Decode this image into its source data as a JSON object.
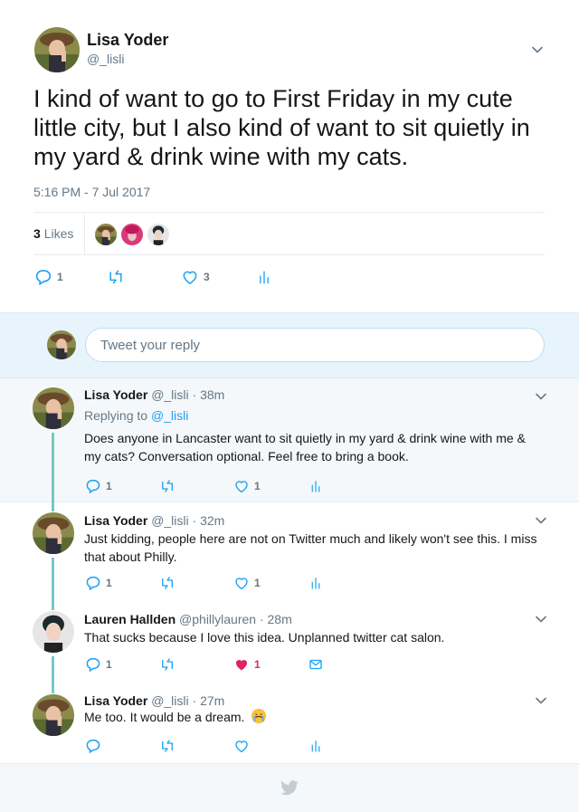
{
  "main_tweet": {
    "name": "Lisa Yoder",
    "handle": "@_lisli",
    "text": "I kind of want to go to First Friday in my cute little city, but I also kind of want to sit quietly in my yard & drink wine with my cats.",
    "timestamp": "5:16 PM - 7 Jul 2017",
    "likes_count": "3",
    "likes_label": "Likes",
    "reply_count": "1",
    "retweet_count": "",
    "like_count": "3"
  },
  "reply_box": {
    "placeholder": "Tweet your reply"
  },
  "replies": [
    {
      "name": "Lisa Yoder",
      "handle": "@_lisli",
      "time": "· 38m",
      "replying_prefix": "Replying to",
      "replying_to": "@_lisli",
      "text": "Does anyone in Lancaster want to sit quietly in my yard & drink wine with me & my cats? Conversation optional. Feel free to bring a book.",
      "reply_count": "1",
      "like_count": "1",
      "liked": false
    },
    {
      "name": "Lisa Yoder",
      "handle": "@_lisli",
      "time": "· 32m",
      "text": "Just kidding, people here are not on Twitter much and likely won't see this. I miss that about Philly.",
      "reply_count": "1",
      "like_count": "1",
      "liked": false
    },
    {
      "name": "Lauren Hallden",
      "handle": "@phillylauren",
      "time": "· 28m",
      "text": "That sucks because I love this idea. Unplanned twitter cat salon.",
      "reply_count": "1",
      "like_count": "1",
      "liked": true
    },
    {
      "name": "Lisa Yoder",
      "handle": "@_lisli",
      "time": "· 27m",
      "text": "Me too. It would be a dream.",
      "reply_count": "",
      "like_count": "",
      "liked": false
    }
  ],
  "colors": {
    "accent": "#1da1f2",
    "like": "#e0245e",
    "thread": "#77c9c4",
    "muted": "#657786"
  },
  "icons": [
    "chevron-down-icon",
    "reply-icon",
    "retweet-icon",
    "heart-icon",
    "analytics-icon",
    "dm-icon",
    "twitter-bird-icon",
    "crying-emoji-icon"
  ]
}
